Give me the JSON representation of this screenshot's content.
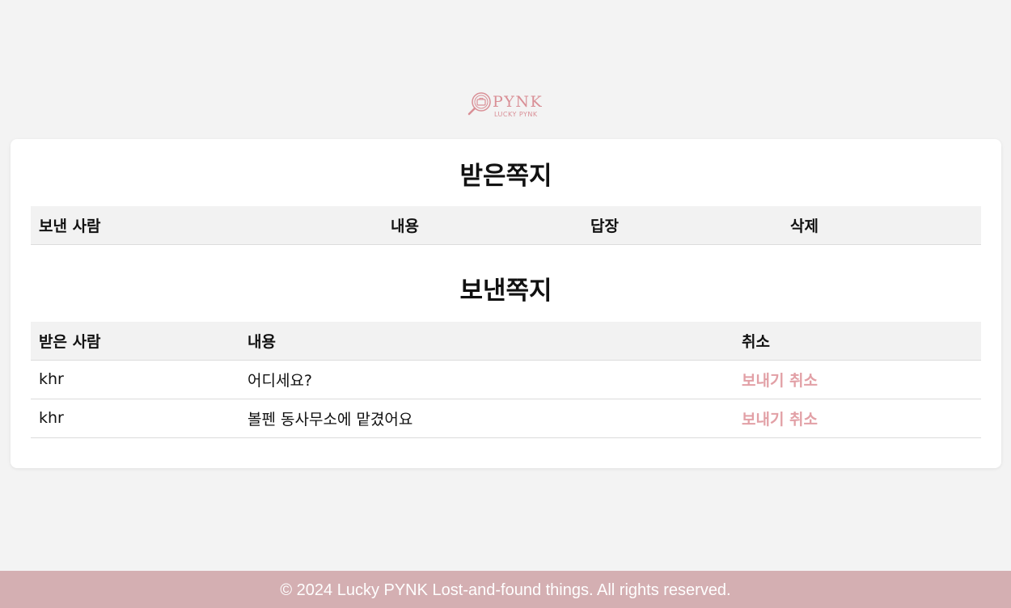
{
  "logo": {
    "brand": "PYNK",
    "tagline": "LUCKY PYNK"
  },
  "received": {
    "title": "받은쪽지",
    "columns": [
      "보낸 사람",
      "내용",
      "답장",
      "삭제"
    ]
  },
  "sent": {
    "title": "보낸쪽지",
    "columns": [
      "받은 사람",
      "내용",
      "취소"
    ],
    "rows": [
      {
        "recipient": "khr",
        "content": "어디세요?",
        "action": "보내기 취소"
      },
      {
        "recipient": "khr",
        "content": "볼펜 동사무소에 맡겼어요",
        "action": "보내기 취소"
      }
    ]
  },
  "footer": {
    "text": "© 2024 Lucky PYNK Lost-and-found things. All rights reserved."
  },
  "colors": {
    "accent": "#e2a0a6",
    "footer_bg": "#d4afb2"
  }
}
